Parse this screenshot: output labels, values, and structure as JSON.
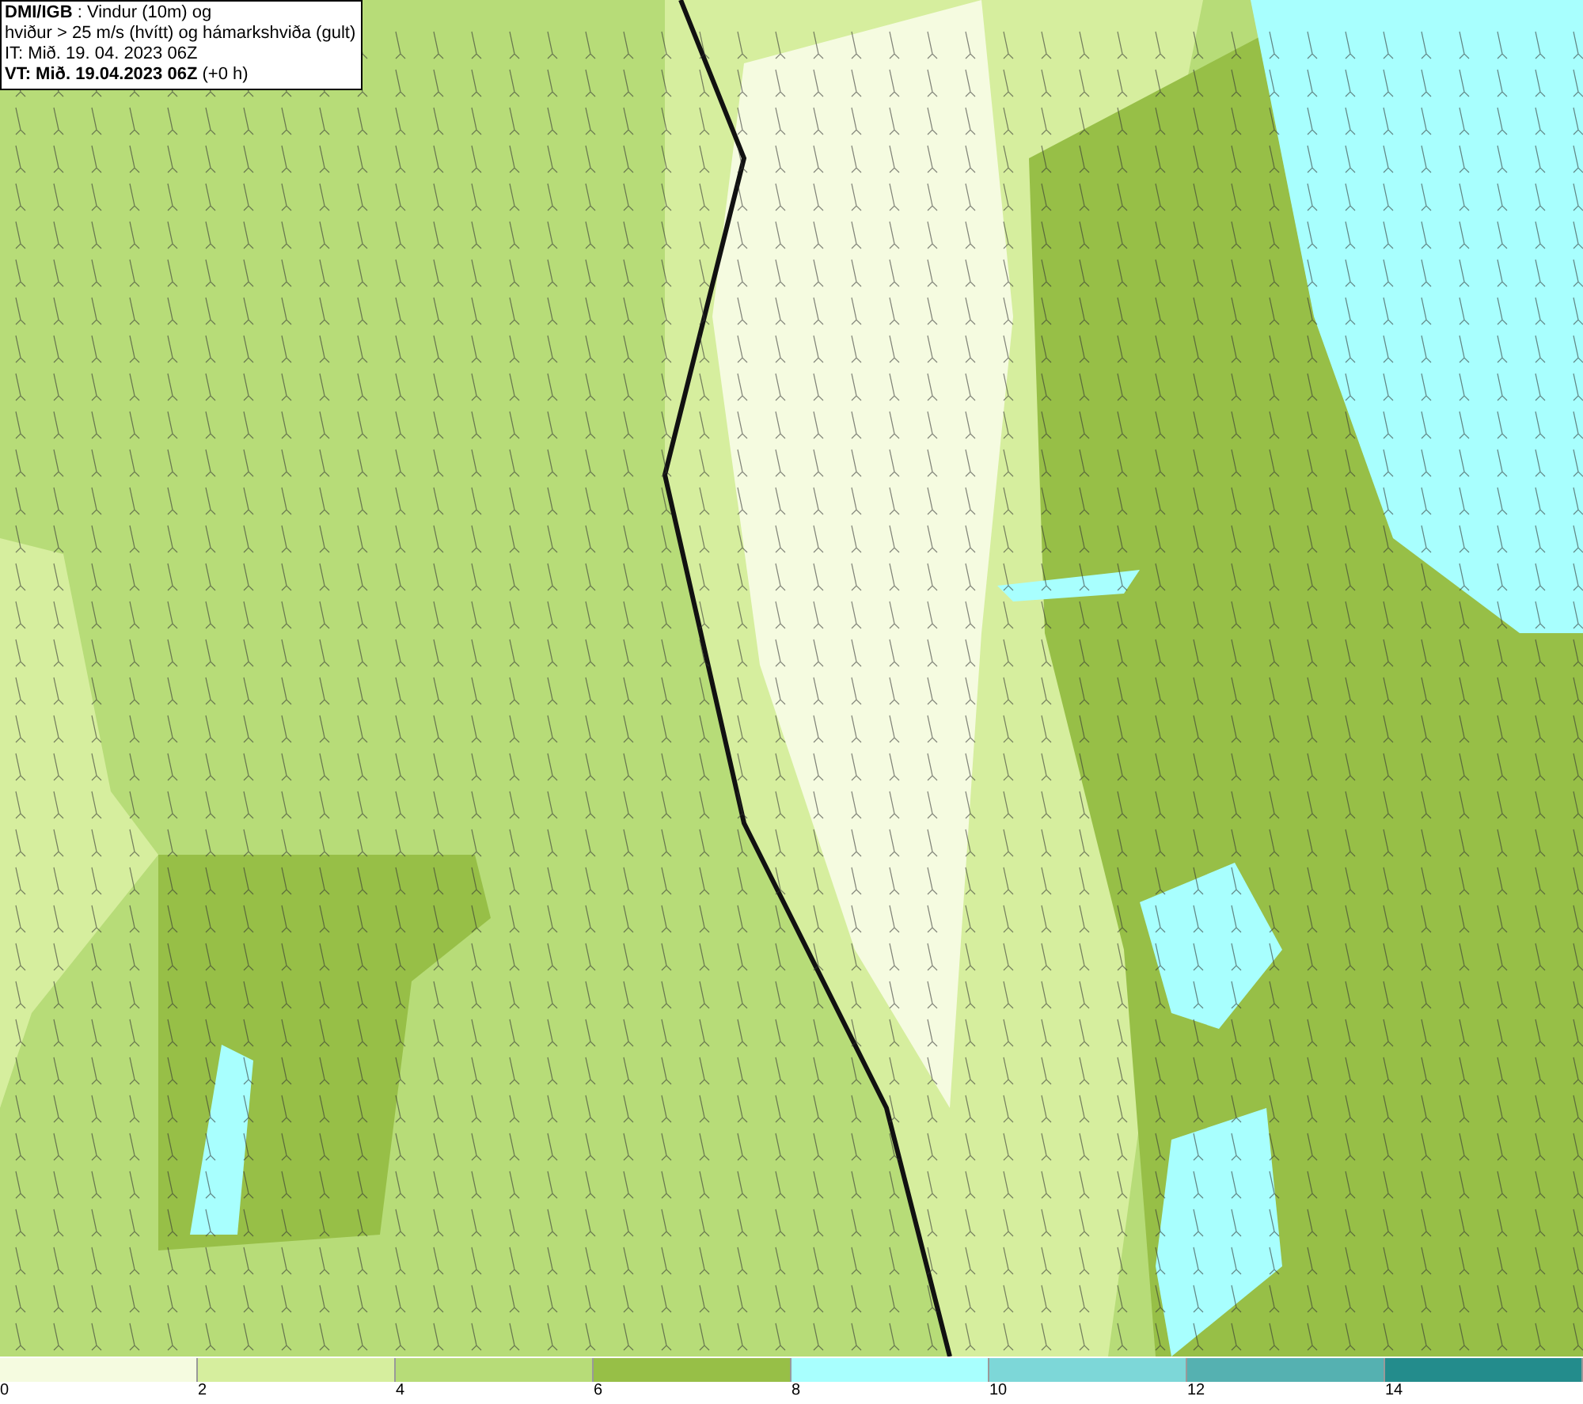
{
  "header": {
    "lines": [
      "**DMI/IGB** : Vindur (10m) og",
      "hviður > 25 m/s (hvítt) og hámarkshviða (gult)",
      "IT: Mið. 19. 04. 2023 06Z",
      "**VT: Mið. 19.04.2023 06Z** (+0 h)"
    ]
  },
  "legend": {
    "segments": [
      {
        "label": "0",
        "color": "#f5fbe0"
      },
      {
        "label": "2",
        "color": "#d6ee9e"
      },
      {
        "label": "4",
        "color": "#b7dc78"
      },
      {
        "label": "6",
        "color": "#97bf47"
      },
      {
        "label": "8",
        "color": "#a8fffe"
      },
      {
        "label": "10",
        "color": "#7dd7d8"
      },
      {
        "label": "12",
        "color": "#55b1b1"
      },
      {
        "label": "14",
        "color": "#238c8c"
      }
    ]
  }
}
